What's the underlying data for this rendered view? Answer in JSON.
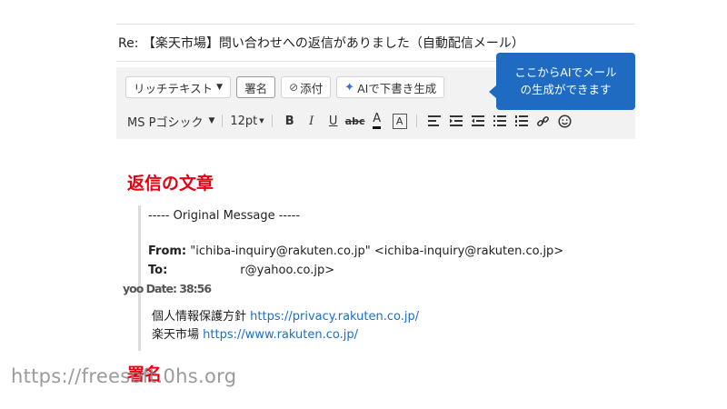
{
  "subject": "Re: 【楽天市場】問い合わせへの返信がありました（自動配信メール）",
  "toolbar": {
    "rich_text": "リッチテキスト",
    "signature": "署名",
    "attach": "添付",
    "ai_write": "AIで下書き生成",
    "font_name": "MS Pゴシック",
    "font_size": "12pt",
    "bold": "B",
    "italic": "I",
    "underline": "U",
    "strike": "abc",
    "font_color": "A",
    "bg_color": "A"
  },
  "tooltip": {
    "line1": "ここからAIでメール",
    "line2": "の生成ができます"
  },
  "body": {
    "reply_heading": "返信の文章",
    "original_message": "----- Original Message -----",
    "from_label": "From:",
    "from_value": " \"ichiba-inquiry@rakuten.co.jp\" <ichiba-inquiry@rakuten.co.jp>",
    "to_label": "To:",
    "to_value": "r@yahoo.co.jp>",
    "date_garbled": "yoo Date: 38:56",
    "privacy_label": "個人情報保護方針 ",
    "privacy_url": "https://privacy.rakuten.co.jp/",
    "ichiba_label": "楽天市場 ",
    "ichiba_url": "https://www.rakuten.co.jp/",
    "signature_heading": "署名"
  },
  "watermark": "https://freesoft.0hs.org",
  "colors": {
    "accent_red": "#e60012",
    "tooltip_blue": "#1f6bc1",
    "link_blue": "#1a6fce"
  }
}
